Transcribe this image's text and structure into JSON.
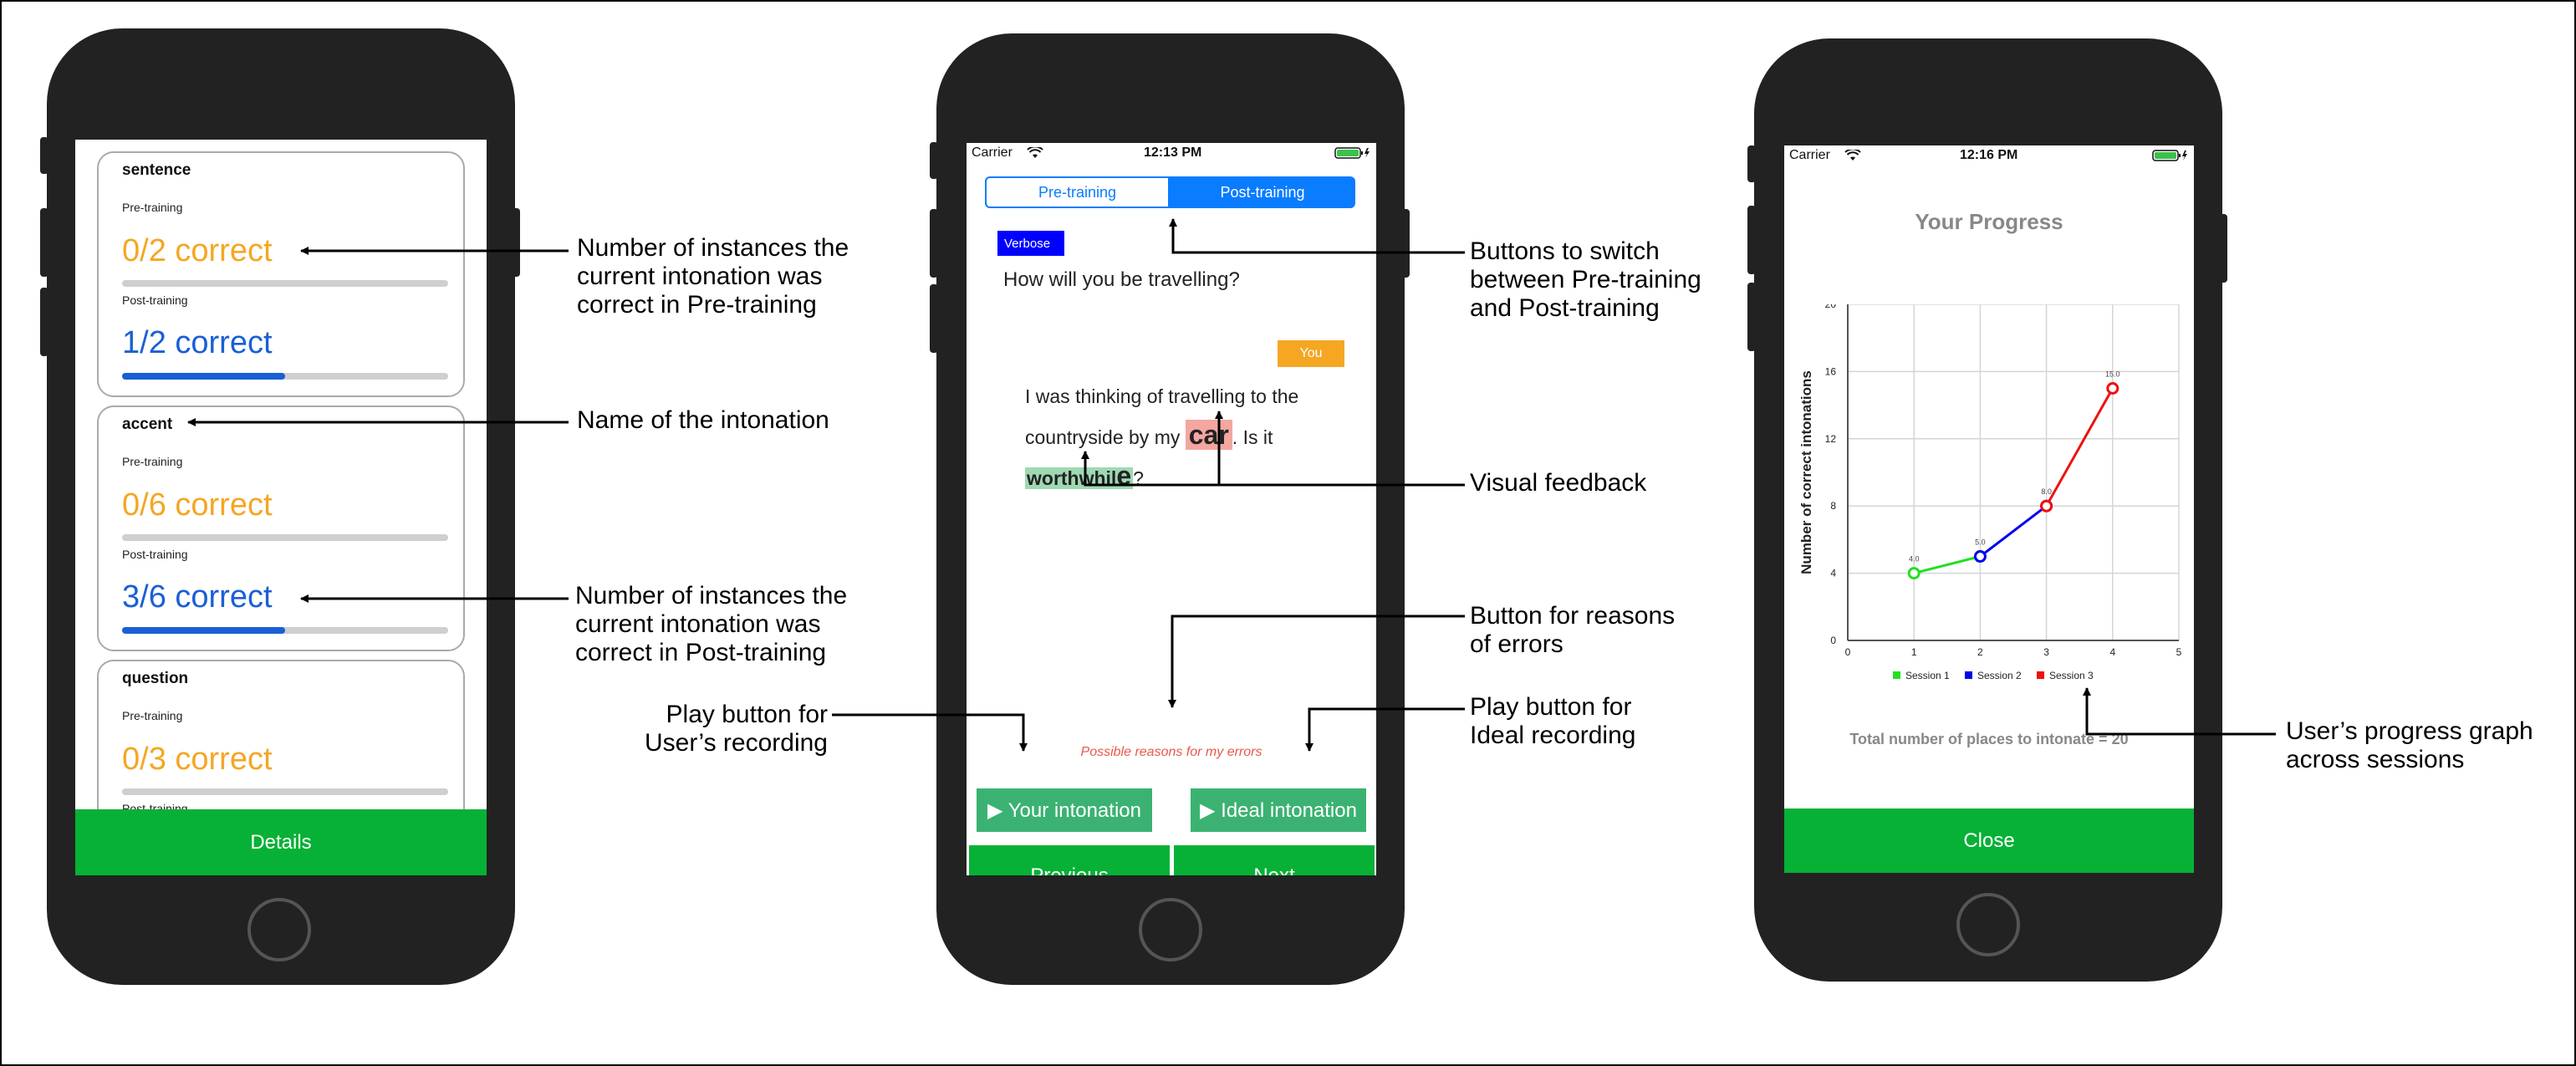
{
  "phone1": {
    "cards": [
      {
        "title": "sentence",
        "pre_label": "Pre-training",
        "pre_value": "0/2 correct",
        "post_label": "Post-training",
        "post_value": "1/2 correct",
        "pre_progress": 0.0,
        "post_progress": 0.5
      },
      {
        "title": "accent",
        "pre_label": "Pre-training",
        "pre_value": "0/6 correct",
        "post_label": "Post-training",
        "post_value": "3/6 correct",
        "pre_progress": 0.0,
        "post_progress": 0.5
      },
      {
        "title": "question",
        "pre_label": "Pre-training",
        "pre_value": "0/3 correct",
        "post_label": "Post-training",
        "pre_progress": 0.0
      }
    ],
    "details_button": "Details"
  },
  "phone2": {
    "status": {
      "carrier": "Carrier",
      "time": "12:13 PM"
    },
    "tabs": [
      "Pre-training",
      "Post-training"
    ],
    "verbose_badge": "Verbose",
    "question": "How will you be travelling?",
    "you_badge": "You",
    "answer": {
      "part1": "I was thinking of travelling to the",
      "part2": "countryside by my ",
      "highlight1": "car",
      "part3": ". Is it",
      "highlight2a": "worthwhil",
      "highlight2b": "e",
      "part4": "?"
    },
    "reasons_link": "Possible reasons for my errors",
    "your_intonation": "▶ Your intonation",
    "ideal_intonation": "▶ Ideal intonation",
    "previous": "Previous",
    "next": "Next"
  },
  "phone3": {
    "status": {
      "carrier": "Carrier",
      "time": "12:16 PM"
    },
    "title": "Your Progress",
    "total": "Total number of places to intonate = 20",
    "close": "Close"
  },
  "chart_data": {
    "type": "line",
    "ylabel": "Number of correct intonations",
    "xlabel": "",
    "xlim": [
      0,
      5
    ],
    "ylim": [
      0,
      20
    ],
    "xticks": [
      "0",
      "1",
      "2",
      "3",
      "4",
      "5"
    ],
    "yticks": [
      "0",
      "4",
      "8",
      "12",
      "16",
      "20"
    ],
    "grid": true,
    "legend_position": "bottom",
    "series": [
      {
        "name": "Session 1",
        "color": "#22e022",
        "x": [
          1,
          2
        ],
        "y": [
          4.0,
          5.0
        ],
        "labels": [
          "4.0",
          "5.0"
        ]
      },
      {
        "name": "Session 2",
        "color": "#0000ee",
        "x": [
          2,
          3
        ],
        "y": [
          5.0,
          8.0
        ],
        "labels": [
          "",
          "8.0"
        ]
      },
      {
        "name": "Session 3",
        "color": "#ee1111",
        "x": [
          3,
          4
        ],
        "y": [
          8.0,
          15.0
        ],
        "labels": [
          "",
          "15.0"
        ]
      }
    ]
  },
  "annotations": {
    "pre_training": [
      "Number of instances the",
      "current intonation was",
      "correct in Pre-training"
    ],
    "name": "Name of the intonation",
    "post_training": [
      "Number of instances the",
      "current intonation was",
      "correct in Post-training"
    ],
    "buttons_switch": [
      "Buttons to switch",
      "between Pre-training",
      "and Post-training"
    ],
    "visual_feedback": "Visual feedback",
    "reasons": [
      "Button for reasons",
      "of errors"
    ],
    "play_user": [
      "Play button for",
      "User’s recording"
    ],
    "play_ideal": [
      "Play button for",
      "Ideal recording"
    ],
    "progress_graph": [
      "User’s progress graph",
      "across sessions"
    ]
  },
  "colors": {
    "green": "#07b136",
    "blue": "#0a7cff",
    "orange": "#f5a623",
    "accent_blue": "#1a5fd6",
    "error_red": "#f4a6a0",
    "ok_green": "#9ed9b3"
  }
}
